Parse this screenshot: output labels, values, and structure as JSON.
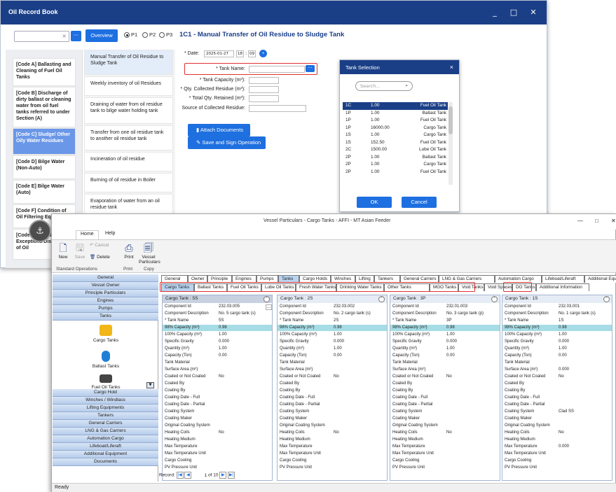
{
  "orb": {
    "title": "Oil Record Book",
    "window_controls": [
      "_",
      "□",
      "✕"
    ],
    "search_clear": "×",
    "dots": "···",
    "overview": "Overview",
    "radios": [
      {
        "label": "P1",
        "on": true
      },
      {
        "label": "P2",
        "on": false
      },
      {
        "label": "P3",
        "on": false
      }
    ],
    "heading": "1C1 - Manual Transfer of Oil Residue to Sludge Tank",
    "codes": [
      "[Code A] Ballasting and Cleaning of Fuel Oil Tanks",
      "[Code B] Discharge of dirty ballast or cleaning water from oil fuel tanks referred to under Section (A)",
      "[Code C] Sludge/ Other Oily Water Residues",
      "[Code D] Bilge Water (Non-Auto)",
      "[Code E] Bilge Water (Auto)",
      "[Code F] Condition of Oil Filtering Equi",
      "[Code G] Accide Other Exceptiona Discharges of Oil"
    ],
    "operations": [
      "Manual Transfer of Oil Residue to Sludge Tank",
      "Weekly inventory of oil Residues",
      "Draining of water from oil residue tank to bilge water holding tank",
      "Transfer from one oil residue tank to another oil residue tank",
      "Incineration of oil residue",
      "Burning of oil residue in Boiler",
      "Evaporation of water from an oil residue tank"
    ],
    "form": {
      "date_label": "* Date:",
      "date_value": "2025-01-27",
      "hour": "18",
      "minute": "09",
      "tank_name_label": "* Tank Name:",
      "tank_capacity_label": "* Tank Capacity (m³):",
      "qty_collected_label": "* Qty. Collected Residue (m³):",
      "total_retained_label": "* Total Qty. Retained (m³):",
      "source_label": "Source of Collected Residue:",
      "attach": "Attach Documents",
      "save_sign": "Save and Sign Operation"
    },
    "tank_selection": {
      "title": "Tank Selection",
      "close": "×",
      "search_placeholder": "Search...",
      "rows": [
        [
          "1C",
          "1.00",
          "Fuel Oil Tank"
        ],
        [
          "1P",
          "1.00",
          "Ballast Tank"
        ],
        [
          "1P",
          "1.00",
          "Fuel Oil Tank"
        ],
        [
          "1P",
          "16000.00",
          "Cargo Tank"
        ],
        [
          "1S",
          "1.00",
          "Cargo Tank"
        ],
        [
          "1S",
          "152.50",
          "Fuel Oil Tank"
        ],
        [
          "2C",
          "1500.00",
          "Lube Oil Tank"
        ],
        [
          "2P",
          "1.00",
          "Ballast Tank"
        ],
        [
          "2P",
          "1.00",
          "Cargo Tank"
        ],
        [
          "2P",
          "1.00",
          "Fuel Oil Tank"
        ]
      ],
      "ok": "OK",
      "cancel": "Cancel"
    }
  },
  "vp": {
    "title": "Vessel Particulars - Cargo Tanks - AFFI - MT Asian Feeder",
    "window_controls": [
      "—",
      "□",
      "✕"
    ],
    "ribbon_tabs": [
      "Home",
      "Help"
    ],
    "ribbon_buttons": [
      {
        "label": "New",
        "icon": "new-icon",
        "enabled": true
      },
      {
        "label": "Save",
        "icon": "save-icon",
        "enabled": false
      },
      {
        "label": "Cancel",
        "icon": "cancel-icon",
        "enabled": false
      },
      {
        "label": "Delete",
        "icon": "delete-icon",
        "enabled": true
      },
      {
        "label": "Print",
        "icon": "print-icon",
        "enabled": true
      },
      {
        "label": "Vessel Particulars",
        "icon": "vessel-particulars-icon",
        "enabled": true
      }
    ],
    "ribbon_groups": [
      "Standard Operations",
      "Print",
      "Copy"
    ],
    "sidebar_top": [
      "General",
      "Vessel Owner",
      "Principle Particulars",
      "Engines",
      "Pumps",
      "Tanks"
    ],
    "sidebar_icons": [
      "Cargo Tanks",
      "Ballast Tanks",
      "Fuel Oil Tanks"
    ],
    "sidebar_bottom": [
      "Cargo Hold",
      "Winches / Windlass",
      "Lifting Equipments",
      "Tankers",
      "General Carriers",
      "LNG & Gas Carriers",
      "Automation Cargo",
      "Lifeboat/Liferaft",
      "Additional Equipment",
      "Documents"
    ],
    "tabs1": [
      "General",
      "Owner",
      "Principle",
      "Engines",
      "Pumps",
      "Tanks",
      "Cargo Holds",
      "Winches",
      "Lifting",
      "Tankers",
      "General Carriers",
      "LNG & Gas Carriers",
      "Automation Cargo",
      "Lifeboat/Liferaft",
      "Additional Equipment"
    ],
    "tabs2": [
      "Cargo Tanks",
      "Ballast Tanks",
      "Fuel Oil Tanks",
      "Lube Oil Tanks",
      "Fresh Water Tanks",
      "Drinking Water Tanks",
      "Other Tanks",
      "MGO Tanks",
      "Void Tanks",
      "Void Spaces",
      "DO Tanks",
      "Additional Information"
    ],
    "field_labels": [
      "Component Id",
      "Component Description",
      "* Tank Name",
      "98% Capacity (m³)",
      "100% Capacity (m³)",
      "Specific Gravity",
      "Quantity (m³)",
      "Capacity (Ton)",
      "Tank Material",
      "Surface Area (m²)",
      "Coated or Not Coated",
      "Coated By",
      "Coating By",
      "Coating Date - Full",
      "Coating Date - Partial",
      "Coating System",
      "Coating Maker",
      "Original Coating System",
      "Heating Coils",
      "Heating Medium",
      "Max Temperature",
      "Max Temperature Unit",
      "Cargo Cooling",
      "PV Pressure Unit"
    ],
    "cards": [
      {
        "header": "Cargo Tank : 5S",
        "values": [
          "232.03.005",
          "No. 5 cargo tank (s)",
          "5S",
          "0.98",
          "1.00",
          "0.000",
          "1.00",
          "0.00",
          "",
          "",
          "No",
          "",
          "",
          "",
          "",
          "",
          "",
          "",
          "No",
          "",
          "",
          "",
          "",
          ""
        ]
      },
      {
        "header": "Cargo Tank : 2S",
        "values": [
          "232.03.002",
          "No. 2 cargo tank (s)",
          "2S",
          "0.98",
          "1.00",
          "0.000",
          "1.00",
          "0.00",
          "",
          "",
          "No",
          "",
          "",
          "",
          "",
          "",
          "",
          "",
          "No",
          "",
          "",
          "",
          "",
          ""
        ]
      },
      {
        "header": "Cargo Tank : 3P",
        "values": [
          "232.01.003",
          "No. 3 cargo tank (p)",
          "3P",
          "0.98",
          "1.00",
          "0.000",
          "1.00",
          "0.00",
          "",
          "",
          "No",
          "",
          "",
          "",
          "",
          "",
          "",
          "",
          "No",
          "",
          "",
          "",
          "",
          ""
        ]
      },
      {
        "header": "Cargo Tank : 1S",
        "values": [
          "232.03.001",
          "No. 1 cargo tank (s)",
          "1S",
          "0.98",
          "1.00",
          "0.000",
          "1.00",
          "0.00",
          "",
          "0.000",
          "No",
          "",
          "",
          "",
          "",
          "Clad SS",
          "",
          "",
          "No",
          "",
          "0.000",
          "",
          "",
          ""
        ]
      }
    ],
    "navigator": {
      "label": "Record:",
      "current": "1",
      "of": "of",
      "total": "10"
    },
    "status": "Ready"
  }
}
